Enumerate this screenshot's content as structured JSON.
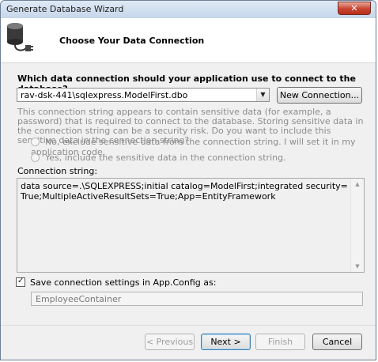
{
  "window": {
    "title": "Generate Database Wizard",
    "close_glyph": "✕"
  },
  "header": {
    "icon": "database-plug-icon",
    "title": "Choose Your Data Connection"
  },
  "connection": {
    "question": "Which data connection should your application use to connect to the database?",
    "selected": "rav-dsk-441\\sqlexpress.ModelFirst.dbo",
    "new_connection_label": "New Connection..."
  },
  "sensitive": {
    "text": "This connection string appears to contain sensitive data (for example, a password) that is required to connect to the database. Storing sensitive data in the connection string can be a security risk. Do you want to include this sensitive data in the connection string?",
    "options": [
      "No, exclude sensitive data from the connection string. I will set it in my application code.",
      "Yes, include the sensitive data in the connection string."
    ]
  },
  "connection_string": {
    "label": "Connection string:",
    "value": "data source=.\\SQLEXPRESS;initial catalog=ModelFirst;integrated security=True;MultipleActiveResultSets=True;App=EntityFramework"
  },
  "save": {
    "checked": true,
    "label": "Save connection settings in App.Config as:",
    "value": "EmployeeContainer"
  },
  "buttons": {
    "previous": "< Previous",
    "next": "Next >",
    "finish": "Finish",
    "cancel": "Cancel"
  }
}
